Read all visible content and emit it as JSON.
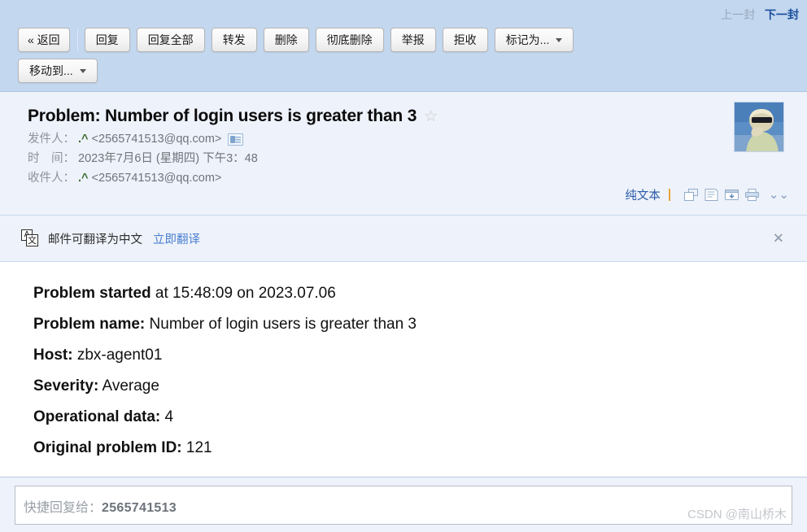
{
  "toolbar": {
    "nav": {
      "prev_label": "上一封",
      "next_label": "下一封"
    },
    "buttons_row1": [
      {
        "label": "« 返回",
        "name": "back-button",
        "caret": false
      },
      {
        "label": "回复",
        "name": "reply-button",
        "caret": false
      },
      {
        "label": "回复全部",
        "name": "reply-all-button",
        "caret": false
      },
      {
        "label": "转发",
        "name": "forward-button",
        "caret": false
      },
      {
        "label": "删除",
        "name": "delete-button",
        "caret": false
      },
      {
        "label": "彻底删除",
        "name": "delete-permanently-button",
        "caret": false
      },
      {
        "label": "举报",
        "name": "report-button",
        "caret": false
      },
      {
        "label": "拒收",
        "name": "reject-button",
        "caret": false
      },
      {
        "label": "标记为...",
        "name": "mark-as-dropdown",
        "caret": true
      }
    ],
    "buttons_row2": [
      {
        "label": "移动到...",
        "name": "move-to-dropdown",
        "caret": true
      }
    ]
  },
  "mail": {
    "subject": "Problem: Number of login users is greater than 3",
    "star_glyph": "☆",
    "from_label": "发件人：",
    "from_name": ".^",
    "from_address": "<2565741513@qq.com>",
    "date_label": "时　间：",
    "date_value": "2023年7月6日 (星期四) 下午3：48",
    "to_label": "收件人：",
    "to_name": ".^",
    "to_address": "<2565741513@qq.com>",
    "actions": {
      "plain_text_label": "纯文本",
      "icons": [
        {
          "name": "open-in-new-window-icon"
        },
        {
          "name": "notes-icon"
        },
        {
          "name": "save-to-net-disk-icon"
        },
        {
          "name": "print-icon"
        }
      ],
      "more_glyph": "⌄⌄"
    }
  },
  "translate_bar": {
    "icon_top_char": "A",
    "icon_bottom_char": "文",
    "message": "邮件可翻译为中文",
    "action_label": "立即翻译",
    "close_glyph": "✕"
  },
  "body_lines": [
    {
      "label": "Problem started",
      "value": " at 15:48:09 on 2023.07.06"
    },
    {
      "label": "Problem name:",
      "value": " Number of login users is greater than 3"
    },
    {
      "label": "Host:",
      "value": " zbx-agent01"
    },
    {
      "label": "Severity:",
      "value": " Average"
    },
    {
      "label": "Operational data:",
      "value": " 4"
    },
    {
      "label": "Original problem ID:",
      "value": " 121"
    }
  ],
  "footer": {
    "quick_reply_prefix": "快捷回复给：",
    "quick_reply_target": "2565741513",
    "watermark": "CSDN @南山桥木"
  },
  "colors": {
    "toolbar_bg": "#c3d7ef",
    "panel_bg": "#eef2fa",
    "body_bg": "#ffffff",
    "link_blue": "#2a5aa8",
    "translate_link": "#4a7fd1",
    "next_link": "#1b4f9c",
    "prev_link": "#9aa9bb"
  }
}
